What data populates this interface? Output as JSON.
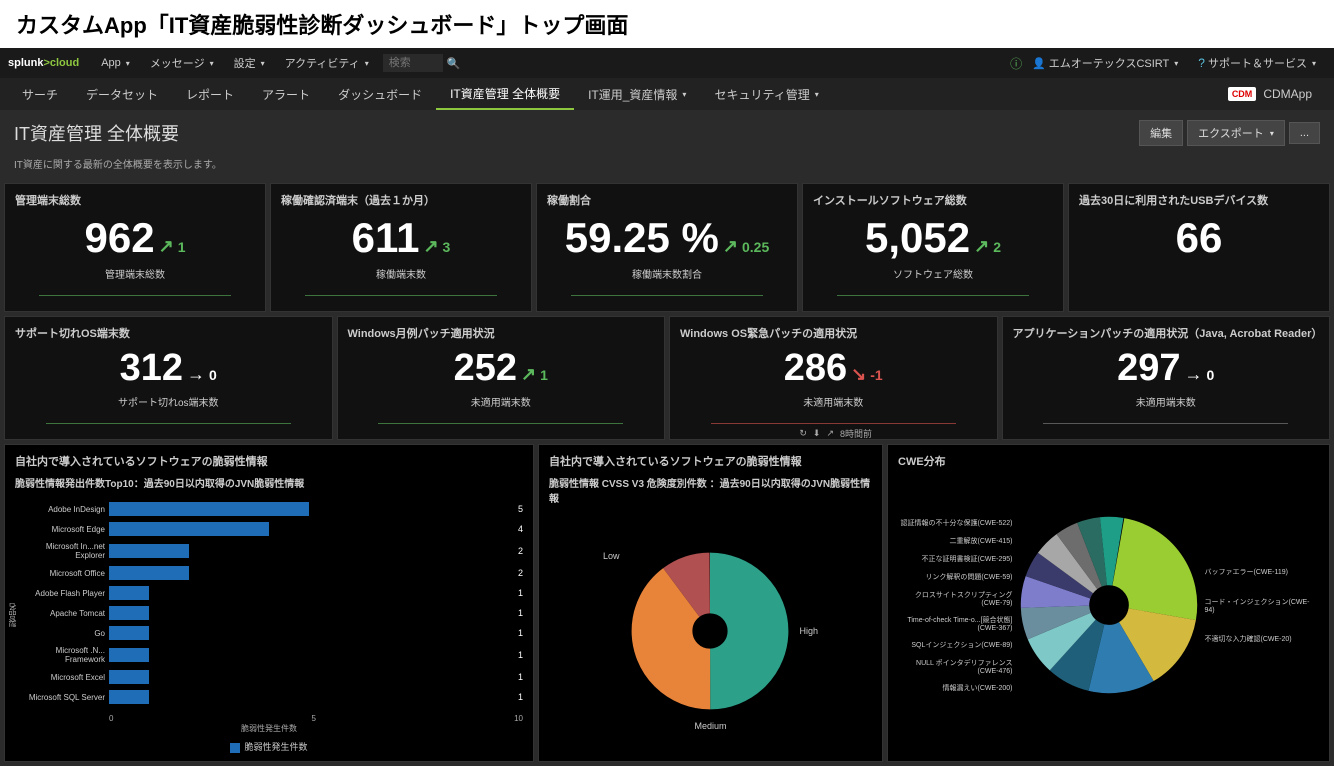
{
  "title_bar": "カスタムApp「IT資産脆弱性診断ダッシュボード」トップ画面",
  "logo": {
    "text1": "splunk",
    "text2": ">cloud"
  },
  "top_nav": {
    "items": [
      "App",
      "メッセージ",
      "設定",
      "アクティビティ"
    ],
    "search_placeholder": "検索",
    "right": {
      "user": "エムオーテックスCSIRT",
      "support": "サポート＆サービス"
    }
  },
  "sub_nav": {
    "items": [
      "サーチ",
      "データセット",
      "レポート",
      "アラート",
      "ダッシュボード",
      "IT資産管理 全体概要",
      "IT運用_資産情報",
      "セキュリティ管理"
    ],
    "active_index": 5,
    "app_name": "CDMApp",
    "app_badge": "CDM"
  },
  "page": {
    "title": "IT資産管理 全体概要",
    "desc": "IT資産に関する最新の全体概要を表示します。",
    "buttons": {
      "edit": "編集",
      "export": "エクスポート",
      "more": "..."
    }
  },
  "kpi_row1": [
    {
      "title": "管理端末総数",
      "value": "962",
      "trend": "up",
      "delta": "1",
      "label": "管理端末総数"
    },
    {
      "title": "稼働確認済端末（過去１か月）",
      "value": "611",
      "trend": "up",
      "delta": "3",
      "label": "稼働端末数"
    },
    {
      "title": "稼働割合",
      "value": "59.25 %",
      "trend": "up",
      "delta": "0.25",
      "label": "稼働端末数割合"
    },
    {
      "title": "インストールソフトウェア総数",
      "value": "5,052",
      "trend": "up",
      "delta": "2",
      "label": "ソフトウェア総数"
    },
    {
      "title": "過去30日に利用されたUSBデバイス数",
      "value": "66",
      "trend": "",
      "delta": "",
      "label": ""
    }
  ],
  "kpi_row2": [
    {
      "title": "サポート切れOS端末数",
      "value": "312",
      "trend": "right",
      "delta": "0",
      "label": "サポート切れos端末数",
      "spark": "green"
    },
    {
      "title": "Windows月例パッチ適用状況",
      "value": "252",
      "trend": "up",
      "delta": "1",
      "label": "未適用端末数",
      "spark": "green"
    },
    {
      "title": "Windows OS緊急パッチの適用状況",
      "value": "286",
      "trend": "down",
      "delta": "-1",
      "label": "未適用端末数",
      "spark": "red"
    },
    {
      "title": "アプリケーションパッチの適用状況（Java, Acrobat Reader）",
      "value": "297",
      "trend": "right",
      "delta": "0",
      "label": "未適用端末数",
      "spark": "gray"
    }
  ],
  "bar_chart": {
    "panel_title": "自社内で導入されているソフトウェアの脆弱性情報",
    "subtitle": "脆弱性情報発出件数Top10：過去90日以内取得のJVN脆弱性情報",
    "y_axis_label": "製品名",
    "x_axis_label": "脆弱性発生件数",
    "legend": "脆弱性発生件数"
  },
  "pie1": {
    "panel_title": "自社内で導入されているソフトウェアの脆弱性情報",
    "subtitle": "脆弱性情報 CVSS V3 危険度別件数 ：過去90日以内取得のJVN脆弱性情報",
    "labels": {
      "high": "High",
      "medium": "Medium",
      "low": "Low"
    },
    "timestamp": "8時間前"
  },
  "pie2": {
    "panel_title": "CWE分布",
    "left_labels": [
      "認証情報の不十分な保護(CWE-522)",
      "二重解放(CWE-415)",
      "不正な証明書検証(CWE-295)",
      "リンク解釈の問題(CWE-59)",
      "クロスサイトスクリプティング(CWE-79)",
      "Time-of-check Time-o...[競合状態](CWE-367)",
      "SQLインジェクション(CWE-89)",
      "NULL ポインタデリファレンス(CWE-476)",
      "情報漏えい(CWE-200)"
    ],
    "right_labels": [
      "バッファエラー(CWE-119)",
      "コード・インジェクション(CWE-94)",
      "不適切な入力確認(CWE-20)"
    ]
  },
  "chart_data": [
    {
      "type": "bar",
      "title": "脆弱性情報発出件数Top10：過去90日以内取得のJVN脆弱性情報",
      "categories": [
        "Adobe InDesign",
        "Microsoft Edge",
        "Microsoft In...net Explorer",
        "Microsoft Office",
        "Adobe Flash Player",
        "Apache Tomcat",
        "Go",
        "Microsoft .N... Framework",
        "Microsoft Excel",
        "Microsoft SQL Server"
      ],
      "values": [
        5,
        4,
        2,
        2,
        1,
        1,
        1,
        1,
        1,
        1
      ],
      "xlabel": "脆弱性発生件数",
      "ylabel": "製品名",
      "xlim": [
        0,
        10
      ]
    },
    {
      "type": "pie",
      "title": "脆弱性情報 CVSS V3 危険度別件数",
      "series": [
        {
          "name": "High",
          "value": 50,
          "color": "#2ca089"
        },
        {
          "name": "Medium",
          "value": 40,
          "color": "#e8833a"
        },
        {
          "name": "Low",
          "value": 10,
          "color": "#b05050"
        }
      ]
    },
    {
      "type": "pie",
      "title": "CWE分布",
      "series": [
        {
          "name": "バッファエラー(CWE-119)",
          "value": 25,
          "color": "#9acd32"
        },
        {
          "name": "コード・インジェクション(CWE-94)",
          "value": 14,
          "color": "#d4b93f"
        },
        {
          "name": "不適切な入力確認(CWE-20)",
          "value": 12,
          "color": "#2f7cb0"
        },
        {
          "name": "情報漏えい(CWE-200)",
          "value": 8,
          "color": "#1f5f7a"
        },
        {
          "name": "NULL ポインタデリファレンス(CWE-476)",
          "value": 7,
          "color": "#7ec8c8"
        },
        {
          "name": "SQLインジェクション(CWE-89)",
          "value": 6,
          "color": "#6b8e9e"
        },
        {
          "name": "Time-of-check Time-of-use(CWE-367)",
          "value": 6,
          "color": "#7d7dcc"
        },
        {
          "name": "クロスサイトスクリプティング(CWE-79)",
          "value": 5,
          "color": "#3b3b6b"
        },
        {
          "name": "リンク解釈の問題(CWE-59)",
          "value": 5,
          "color": "#a7a7a7"
        },
        {
          "name": "不正な証明書検証(CWE-295)",
          "value": 4,
          "color": "#6d6d6d"
        },
        {
          "name": "二重解放(CWE-415)",
          "value": 4,
          "color": "#2b6c62"
        },
        {
          "name": "認証情報の不十分な保護(CWE-522)",
          "value": 4,
          "color": "#1e9e86"
        }
      ]
    }
  ]
}
